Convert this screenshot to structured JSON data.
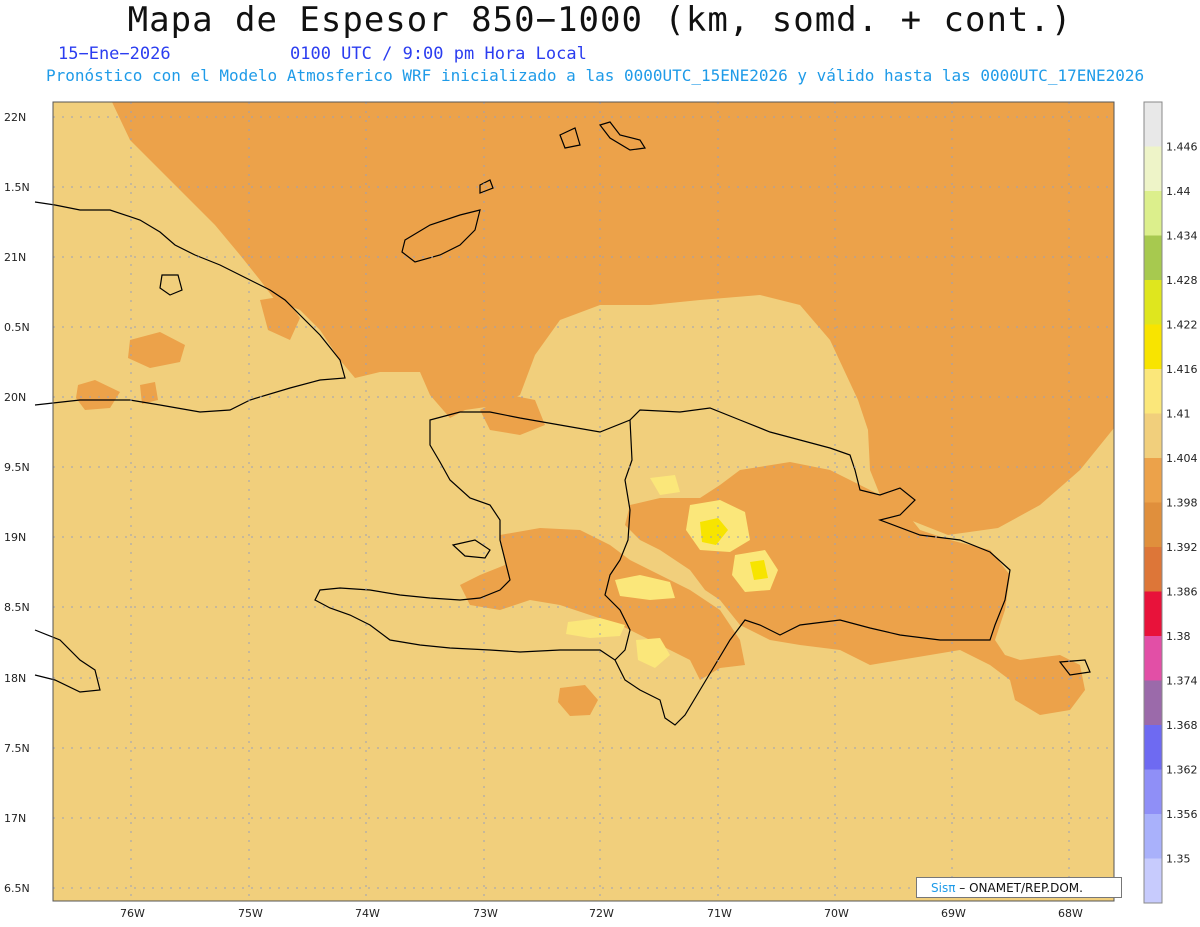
{
  "header": {
    "title": "Mapa de Espesor 850−1000 (km, somd. + cont.)",
    "date": "15−Ene−2026",
    "time": "0100 UTC / 9:00 pm Hora Local",
    "subtitle": "Pronóstico con el Modelo Atmosferico WRF inicializado a las 0000UTC_15ENE2026 y válido hasta las  0000UTC_17ENE2026"
  },
  "map": {
    "lat_labels": [
      "22N",
      "1.5N",
      "21N",
      "0.5N",
      "20N",
      "9.5N",
      "19N",
      "8.5N",
      "18N",
      "7.5N",
      "17N",
      "6.5N"
    ],
    "lon_labels": [
      "76W",
      "75W",
      "74W",
      "73W",
      "72W",
      "71W",
      "70W",
      "69W",
      "68W"
    ],
    "fill_colors": {
      "background": "#f1cf7c",
      "orange": "#eca24a",
      "dark_orange": "#e08f3c",
      "light_yellow": "#fbe77a",
      "yellow": "#f7e400"
    }
  },
  "colorbar": {
    "labels": [
      "1.446",
      "1.44",
      "1.434",
      "1.428",
      "1.422",
      "1.416",
      "1.41",
      "1.404",
      "1.398",
      "1.392",
      "1.386",
      "1.38",
      "1.374",
      "1.368",
      "1.362",
      "1.356",
      "1.35"
    ],
    "colors": [
      "#e8e8e8",
      "#eef4c8",
      "#dcef8c",
      "#a7c94f",
      "#dfe61e",
      "#f8e400",
      "#fbe77a",
      "#f1cf7c",
      "#eca24a",
      "#e08f3c",
      "#dd7638",
      "#e8123a",
      "#e24fa6",
      "#9b6aaa",
      "#6e6af2",
      "#8f8ff7",
      "#a9b1fb",
      "#c7cbfd"
    ]
  },
  "credit": {
    "sis": "Sisπ",
    "text": "– ONAMET/REP.DOM."
  }
}
